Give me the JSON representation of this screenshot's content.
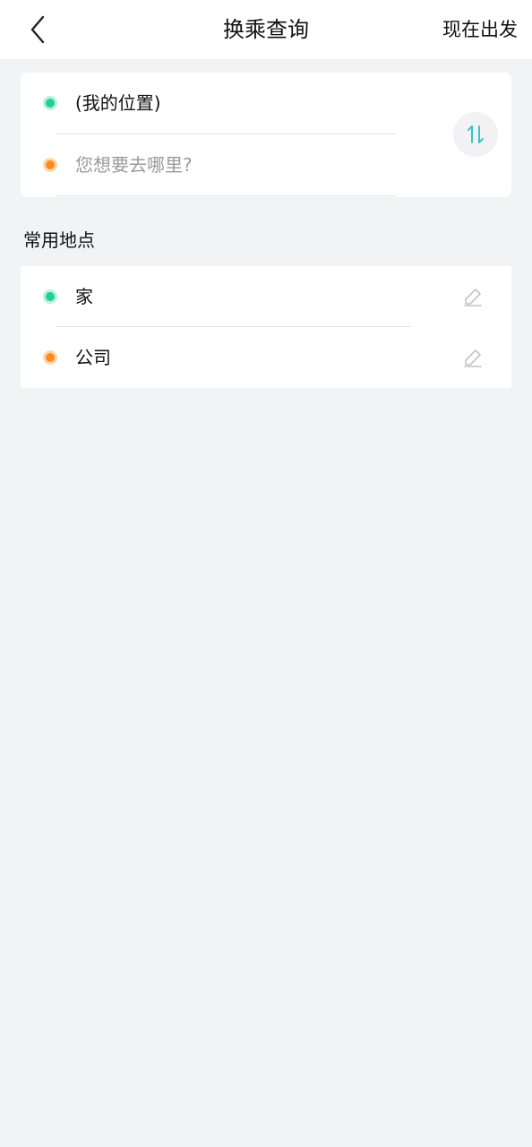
{
  "header": {
    "title": "换乘查询",
    "action_label": "现在出发",
    "back_icon": "chevron-left-icon"
  },
  "route": {
    "origin_value": "(我的位置)",
    "destination_placeholder": "您想要去哪里?",
    "swap_icon": "swap-vertical-icon",
    "origin_color": "#22cf9a",
    "destination_color": "#ff8c1a",
    "swap_icon_color": "#1fc2c2"
  },
  "common_places": {
    "title": "常用地点",
    "items": [
      {
        "label": "家",
        "icon": "edit-pencil-icon"
      },
      {
        "label": "公司",
        "icon": "edit-pencil-icon"
      }
    ]
  }
}
